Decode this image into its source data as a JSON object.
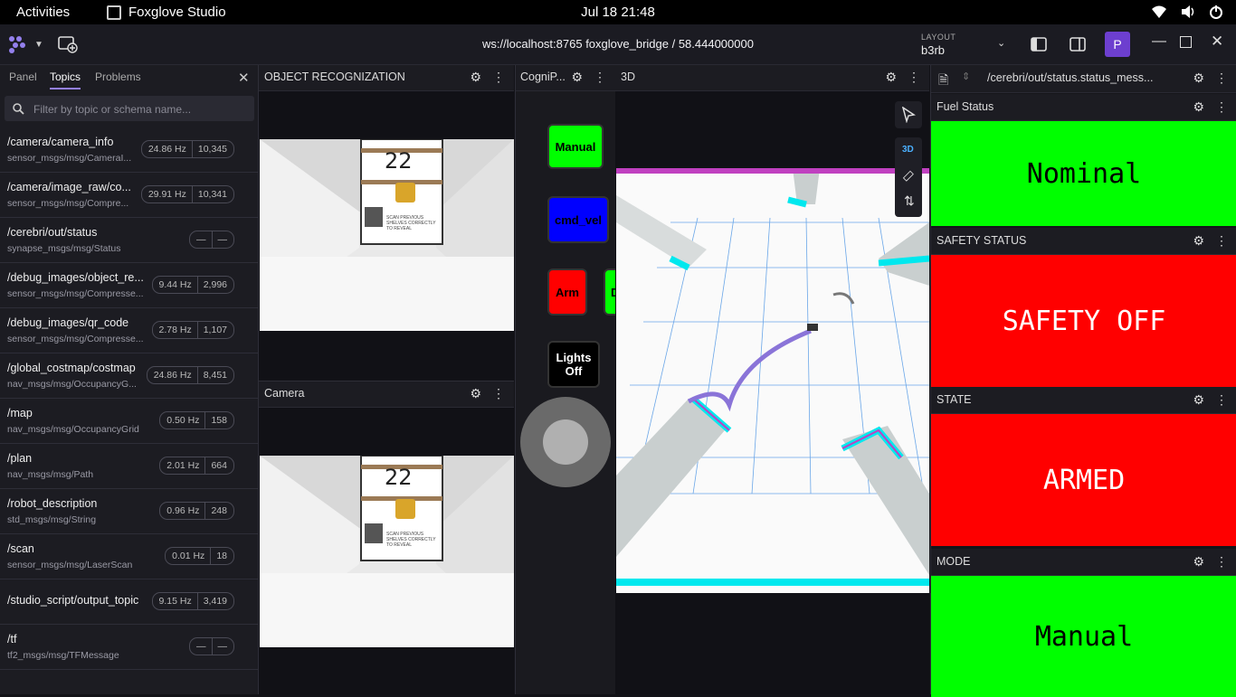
{
  "system_bar": {
    "activities": "Activities",
    "app_name": "Foxglove Studio",
    "clock": "Jul 18  21:48"
  },
  "app_bar": {
    "connection": "ws://localhost:8765 foxglove_bridge / 58.444000000",
    "layout_label": "LAYOUT",
    "layout_name": "b3rb",
    "avatar_letter": "P"
  },
  "sidebar": {
    "tabs": [
      "Panel",
      "Topics",
      "Problems"
    ],
    "active_tab": "Topics",
    "search_placeholder": "Filter by topic or schema name...",
    "topics": [
      {
        "name": "/camera/camera_info",
        "schema": "sensor_msgs/msg/CameraI...",
        "hz": "24.86 Hz",
        "count": "10,345"
      },
      {
        "name": "/camera/image_raw/co...",
        "schema": "sensor_msgs/msg/Compre...",
        "hz": "29.91 Hz",
        "count": "10,341"
      },
      {
        "name": "/cerebri/out/status",
        "schema": "synapse_msgs/msg/Status",
        "hz": "—",
        "count": "—"
      },
      {
        "name": "/debug_images/object_re...",
        "schema": "sensor_msgs/msg/Compresse...",
        "hz": "9.44 Hz",
        "count": "2,996"
      },
      {
        "name": "/debug_images/qr_code",
        "schema": "sensor_msgs/msg/Compresse...",
        "hz": "2.78 Hz",
        "count": "1,107"
      },
      {
        "name": "/global_costmap/costmap",
        "schema": "nav_msgs/msg/OccupancyG...",
        "hz": "24.86 Hz",
        "count": "8,451"
      },
      {
        "name": "/map",
        "schema": "nav_msgs/msg/OccupancyGrid",
        "hz": "0.50 Hz",
        "count": "158"
      },
      {
        "name": "/plan",
        "schema": "nav_msgs/msg/Path",
        "hz": "2.01 Hz",
        "count": "664"
      },
      {
        "name": "/robot_description",
        "schema": "std_msgs/msg/String",
        "hz": "0.96 Hz",
        "count": "248"
      },
      {
        "name": "/scan",
        "schema": "sensor_msgs/msg/LaserScan",
        "hz": "0.01 Hz",
        "count": "18"
      },
      {
        "name": "/studio_script/output_topic",
        "schema": "",
        "hz": "9.15 Hz",
        "count": "3,419"
      },
      {
        "name": "/tf",
        "schema": "tf2_msgs/msg/TFMessage",
        "hz": "—",
        "count": "—"
      }
    ]
  },
  "panels": {
    "object_recognition": {
      "title": "OBJECT RECOGNIZATION",
      "sign_number": "22",
      "sign_text": "SCAN PREVIOUS SHELVES CORRECTLY TO REVEAL"
    },
    "camera": {
      "title": "Camera",
      "sign_number": "22",
      "sign_text": "SCAN PREVIOUS SHELVES CORRECTLY TO REVEAL"
    },
    "cognipilot": {
      "title": "CogniP...",
      "buttons": {
        "manual": "Manual",
        "cmd_vel": "cmd_vel",
        "arm": "Arm",
        "lights_line1": "Lights",
        "lights_line2": "Off",
        "partial": "D"
      }
    },
    "three_d": {
      "title": "3D",
      "mode_label": "3D"
    },
    "status_path": {
      "title": "/cerebri/out/status.status_mess..."
    }
  },
  "status_cards": {
    "fuel": {
      "title": "Fuel Status",
      "value": "Nominal",
      "color": "#00ff00"
    },
    "safety": {
      "title": "SAFETY STATUS",
      "value": "SAFETY OFF",
      "color": "#ff0000"
    },
    "state": {
      "title": "STATE",
      "value": "ARMED",
      "color": "#ff0000"
    },
    "mode": {
      "title": "MODE",
      "value": "Manual",
      "color": "#00ff00"
    }
  },
  "colors": {
    "accent": "#9480ed",
    "avatar": "#6d3fcf"
  }
}
